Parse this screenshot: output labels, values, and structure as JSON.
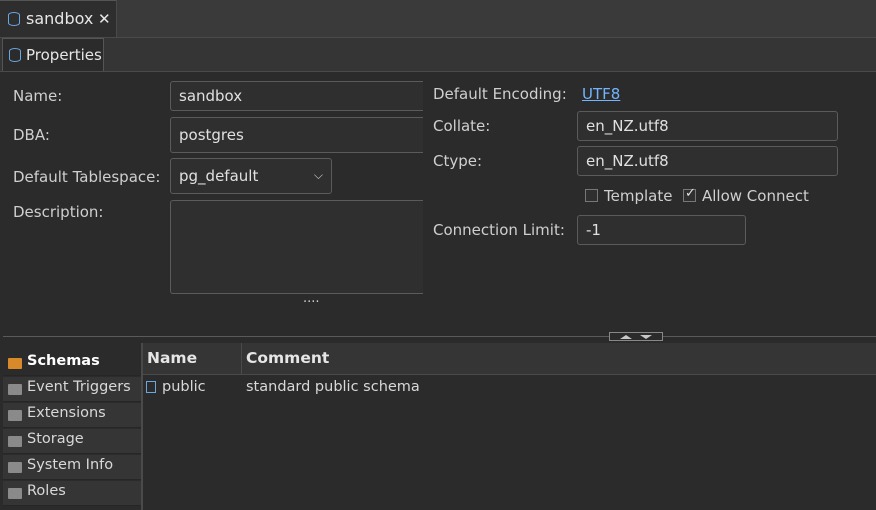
{
  "editor_tab": {
    "label": "sandbox",
    "close": "✕"
  },
  "properties_tab": {
    "label": "Properties"
  },
  "form": {
    "name_label": "Name:",
    "name_value": "sandbox",
    "dba_label": "DBA:",
    "dba_value": "postgres",
    "tablespace_label": "Default Tablespace:",
    "tablespace_value": "pg_default",
    "description_label": "Description:",
    "description_value": "",
    "resize_dots": "....",
    "encoding_label": "Default Encoding:",
    "encoding_value": "UTF8",
    "collate_label": "Collate:",
    "collate_value": "en_NZ.utf8",
    "ctype_label": "Ctype:",
    "ctype_value": "en_NZ.utf8",
    "template_label": "Template",
    "template_checked": false,
    "allow_connect_label": "Allow Connect",
    "allow_connect_checked": true,
    "conn_limit_label": "Connection Limit:",
    "conn_limit_value": "-1"
  },
  "sidebar": {
    "items": [
      {
        "label": "Schemas",
        "icon": "schemas-icon",
        "active": true
      },
      {
        "label": "Event Triggers",
        "icon": "folder-icon"
      },
      {
        "label": "Extensions",
        "icon": "extensions-icon"
      },
      {
        "label": "Storage",
        "icon": "storage-icon"
      },
      {
        "label": "System Info",
        "icon": "system-info-icon"
      },
      {
        "label": "Roles",
        "icon": "roles-icon"
      }
    ]
  },
  "table": {
    "columns": [
      "Name",
      "Comment"
    ],
    "rows": [
      {
        "name": "public",
        "comment": "standard public schema"
      }
    ]
  },
  "colors": {
    "background": "#2b2b2b",
    "link": "#72b5ff",
    "accent_icon": "#6aa7e0"
  }
}
